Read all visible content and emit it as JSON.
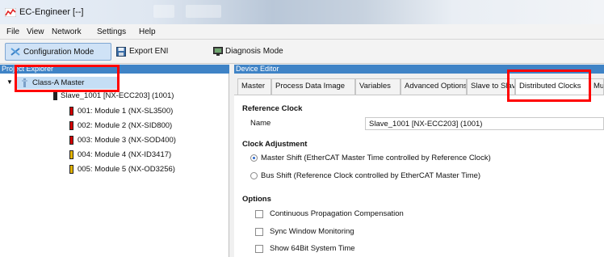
{
  "window": {
    "title": "EC-Engineer [--]"
  },
  "menu": {
    "items": [
      "File",
      "View",
      "Network",
      "Settings",
      "Help"
    ]
  },
  "toolbar": {
    "configuration_mode": "Configuration Mode",
    "export_eni": "Export ENI",
    "diagnosis_mode": "Diagnosis Mode"
  },
  "project_explorer": {
    "title": "Project Explorer",
    "master": "Class-A Master",
    "slave": "Slave_1001 [NX-ECC203] (1001)",
    "modules": [
      "001: Module 1 (NX-SL3500)",
      "002: Module 2 (NX-SID800)",
      "003: Module 3 (NX-SOD400)",
      "004: Module 4 (NX-ID3417)",
      "005: Module 5 (NX-OD3256)"
    ],
    "module_colors": [
      "#d40000",
      "#d40000",
      "#d40000",
      "#e4b300",
      "#e4b300"
    ]
  },
  "device_editor": {
    "title": "Device Editor",
    "tabs": [
      "Master",
      "Process Data Image",
      "Variables",
      "Advanced Options",
      "Slave to Slav",
      "Distributed Clocks",
      "Mu"
    ],
    "active_tab": "Distributed Clocks",
    "reference_clock": {
      "title": "Reference Clock",
      "name_label": "Name",
      "name_value": "Slave_1001 [NX-ECC203] (1001)"
    },
    "clock_adjustment": {
      "title": "Clock Adjustment",
      "option_master": "Master Shift (EtherCAT Master Time controlled by Reference Clock)",
      "option_bus": "Bus Shift (Reference Clock controlled by EtherCAT Master Time)",
      "selected": "Master Shift"
    },
    "options": {
      "title": "Options",
      "continuous": "Continuous Propagation Compensation",
      "sync_window": "Sync Window Monitoring",
      "show_64bit": "Show 64Bit System Time"
    }
  },
  "colors": {
    "accent": "#3f83c6",
    "highlight": "#ff0000",
    "toolbar_active": "#cfe2f6"
  }
}
